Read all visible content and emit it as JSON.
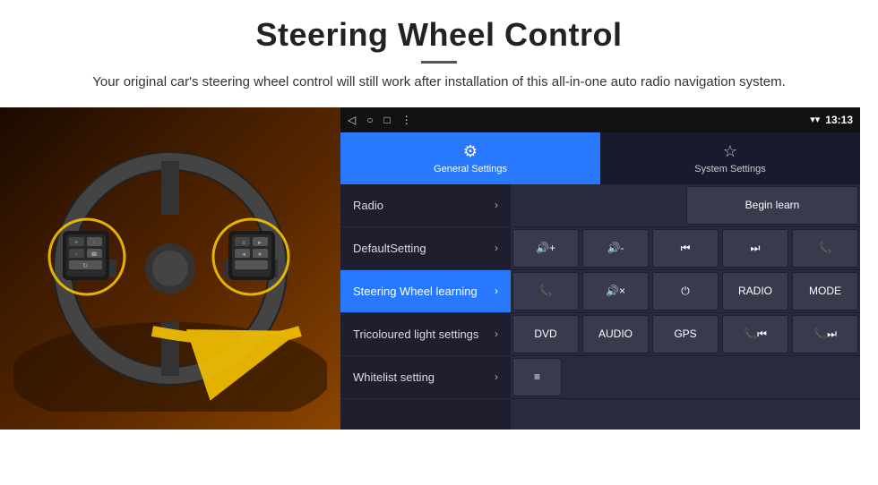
{
  "page": {
    "title": "Steering Wheel Control",
    "divider": true,
    "subtitle": "Your original car's steering wheel control will still work after installation of this all-in-one auto radio navigation system."
  },
  "status_bar": {
    "back_icon": "◁",
    "home_icon": "○",
    "square_icon": "□",
    "menu_icon": "⋮",
    "wifi_icon": "▾",
    "signal_icon": "▾",
    "time": "13:13"
  },
  "tabs": [
    {
      "id": "general",
      "label": "General Settings",
      "icon": "⚙",
      "active": true
    },
    {
      "id": "system",
      "label": "System Settings",
      "icon": "☆",
      "active": false
    }
  ],
  "menu_items": [
    {
      "id": "radio",
      "label": "Radio",
      "active": false
    },
    {
      "id": "default-setting",
      "label": "DefaultSetting",
      "active": false
    },
    {
      "id": "steering-wheel",
      "label": "Steering Wheel learning",
      "active": true
    },
    {
      "id": "tricoloured",
      "label": "Tricoloured light settings",
      "active": false
    },
    {
      "id": "whitelist",
      "label": "Whitelist setting",
      "active": false
    }
  ],
  "control_buttons": {
    "begin_learn": "Begin learn",
    "row1": [
      "🔊+",
      "🔊-",
      "⏮",
      "⏭",
      "📞"
    ],
    "row2": [
      "📞",
      "🔊×",
      "⏻",
      "RADIO",
      "MODE"
    ],
    "row3": [
      "DVD",
      "AUDIO",
      "GPS",
      "📞⏮",
      "📞⏭"
    ],
    "row4_icon": "≡"
  }
}
